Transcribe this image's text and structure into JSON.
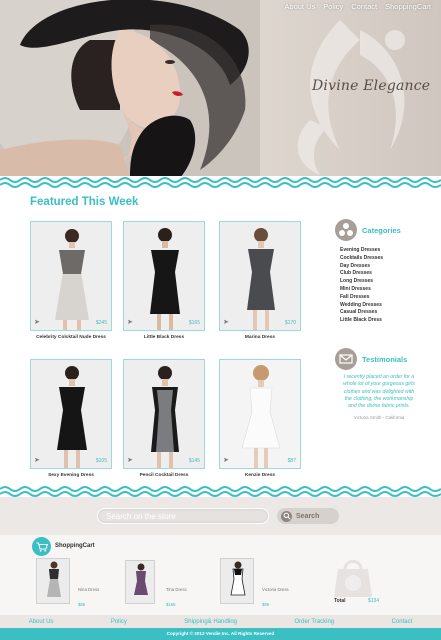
{
  "header": {
    "nav": [
      "About Us",
      "Policy",
      "Contact",
      "ShoppingCart"
    ],
    "tagline": "Divine Elegance"
  },
  "featured": {
    "title": "Featured This Week",
    "products": [
      {
        "name": "Celebrity Colcktail Nude Dress",
        "price": "$245"
      },
      {
        "name": "Little Black Dress",
        "price": "$165"
      },
      {
        "name": "Marina Dress",
        "price": "$170"
      },
      {
        "name": "Sexy Evening Dress",
        "price": "$105"
      },
      {
        "name": "Pencil Cocktail Dress",
        "price": "$145"
      },
      {
        "name": "Kenzie Dress",
        "price": "$87"
      }
    ]
  },
  "sidebar": {
    "categories_title": "Categories",
    "categories": [
      "Evening Dresses",
      "Cocktails Dresses",
      "Day Dresses",
      "Club Dresses",
      "Long Dresses",
      "Mini Dresses",
      "Fall Dresses",
      "Wedding Dresses",
      "Casual Dresses",
      "Little Black Dress"
    ],
    "testimonials_title": "Testimonials",
    "testimonial_text": "I recently placed an order for a whole lot of your gorgeous girls clothes and was delighted with the clothing, the workmanship and the divine fabric prints.",
    "testimonial_author": "Victoria Smith - California"
  },
  "search": {
    "placeholder": "Search on the store",
    "button_label": "Search"
  },
  "cart": {
    "title": "ShoppingCart",
    "items": [
      {
        "name": "Nina Dress",
        "price": "$85"
      },
      {
        "name": "Tina Dress",
        "price": "$165"
      },
      {
        "name": "Victoria Dress",
        "price": "$96"
      }
    ],
    "total_label": "Total",
    "total_value": "$134"
  },
  "footer": {
    "nav": [
      "About Us",
      "Policy",
      "Shipping& Handling",
      "Order Tracking",
      "Contact"
    ],
    "copyright": "Copyright © 2012 Vendie Inc. All Rights Reserved"
  },
  "colors": {
    "accent": "#3bbfc2",
    "hero_background": "#e0dad4",
    "sidebar_icon": "#a79e97"
  },
  "icons": [
    "shopping-cart-icon",
    "categories-icon",
    "envelope-icon",
    "search-icon",
    "arrow-right-icon",
    "shopping-bag-icon"
  ]
}
